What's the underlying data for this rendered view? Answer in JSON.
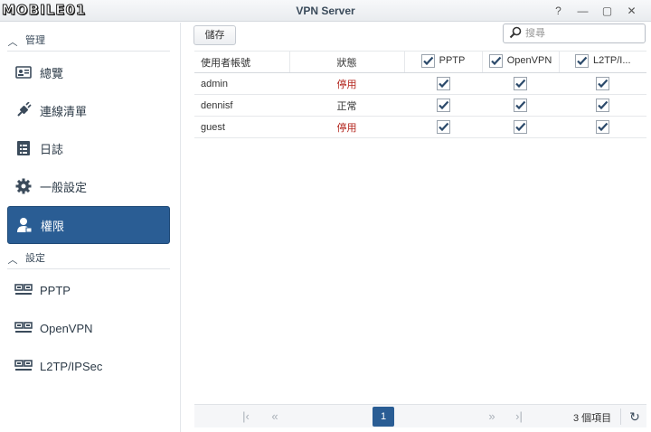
{
  "window": {
    "logo_text": "MOBILE01",
    "title": "VPN Server",
    "controls": [
      "?",
      "—",
      "▢",
      "✕"
    ]
  },
  "sidebar": {
    "section_manage": "管理",
    "section_settings": "設定",
    "items": [
      {
        "label": "總覽",
        "icon": "overview-icon"
      },
      {
        "label": "連線清單",
        "icon": "connection-icon"
      },
      {
        "label": "日誌",
        "icon": "log-icon"
      },
      {
        "label": "一般設定",
        "icon": "gear-icon"
      },
      {
        "label": "權限",
        "icon": "user-permission-icon",
        "active": true
      },
      {
        "label": "PPTP",
        "icon": "network-icon"
      },
      {
        "label": "OpenVPN",
        "icon": "network-icon"
      },
      {
        "label": "L2TP/IPSec",
        "icon": "network-icon"
      }
    ]
  },
  "toolbar": {
    "save_label": "儲存",
    "search_placeholder": "搜尋"
  },
  "table": {
    "headers": {
      "user": "使用者帳號",
      "status": "狀態",
      "pptp": "PPTP",
      "openvpn": "OpenVPN",
      "l2tp": "L2TP/I..."
    },
    "rows": [
      {
        "user": "admin",
        "status": "停用",
        "pptp": true,
        "openvpn": true,
        "l2tp": true
      },
      {
        "user": "dennisf",
        "status": "正常",
        "pptp": true,
        "openvpn": true,
        "l2tp": true
      },
      {
        "user": "guest",
        "status": "停用",
        "pptp": true,
        "openvpn": true,
        "l2tp": true
      }
    ]
  },
  "pager": {
    "current_page": "1",
    "count_text": "3 個項目"
  },
  "colors": {
    "accent": "#2a5d94",
    "stopped": "#b3261e",
    "check": "#2c4a6b"
  }
}
